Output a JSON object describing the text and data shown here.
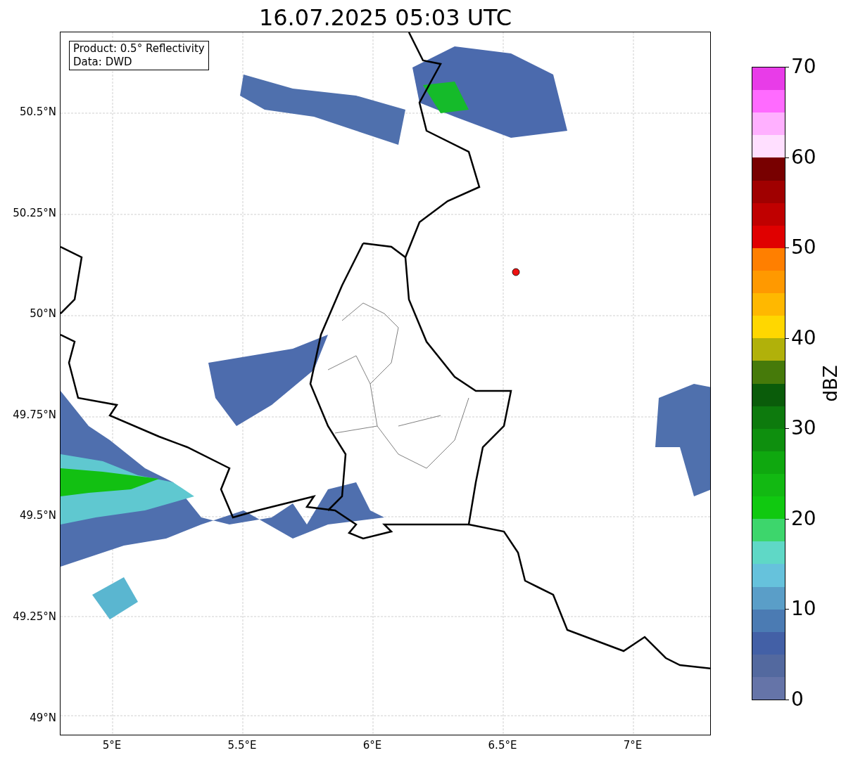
{
  "title": "16.07.2025 05:03 UTC",
  "annotation": [
    "Product: 0.5° Reflectivity",
    "Data: DWD"
  ],
  "lat_ticks": [
    "50.5°N",
    "50.25°N",
    "50°N",
    "49.75°N",
    "49.5°N",
    "49.25°N",
    "49°N"
  ],
  "lon_ticks": [
    "5°E",
    "5.5°E",
    "6°E",
    "6.5°E",
    "7°E"
  ],
  "colorbar": {
    "label": "dBZ",
    "ticks": [
      "70",
      "60",
      "50",
      "40",
      "30",
      "20",
      "10",
      "0"
    ],
    "bins": [
      {
        "color": "#e83ce8"
      },
      {
        "color": "#ff6bff"
      },
      {
        "color": "#ffb0ff"
      },
      {
        "color": "#ffdfff"
      },
      {
        "color": "#780000"
      },
      {
        "color": "#a00000"
      },
      {
        "color": "#c00000"
      },
      {
        "color": "#e00000"
      },
      {
        "color": "#ff7f00"
      },
      {
        "color": "#ff9900"
      },
      {
        "color": "#ffb800"
      },
      {
        "color": "#ffd700"
      },
      {
        "color": "#b1b10a"
      },
      {
        "color": "#467a0a"
      },
      {
        "color": "#0a5c0a"
      },
      {
        "color": "#0d7a0d"
      },
      {
        "color": "#0e8f0e"
      },
      {
        "color": "#0fa80f"
      },
      {
        "color": "#12b912"
      },
      {
        "color": "#10c910"
      },
      {
        "color": "#3dd66c"
      },
      {
        "color": "#5fd8c6"
      },
      {
        "color": "#66c2dc"
      },
      {
        "color": "#5a9ec8"
      },
      {
        "color": "#4b7bb3"
      },
      {
        "color": "#4360a6"
      },
      {
        "color": "#53699f"
      },
      {
        "color": "#6574a8"
      }
    ]
  }
}
